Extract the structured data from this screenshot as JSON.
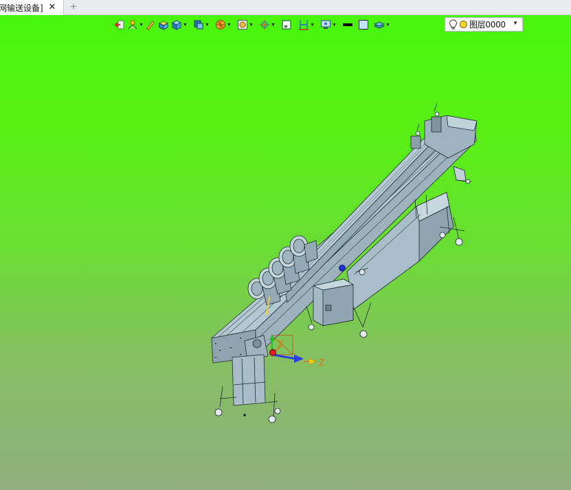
{
  "tab": {
    "title": "网输送设备]",
    "close_icon": "close-icon",
    "add_icon": "plus-icon"
  },
  "toolbar": {
    "buttons": [
      {
        "name": "exit-icon",
        "dropdown": false
      },
      {
        "name": "point-snap-icon",
        "dropdown": true
      },
      {
        "name": "pencil-icon",
        "dropdown": false
      },
      {
        "name": "box-shaded-icon",
        "dropdown": false
      },
      {
        "name": "render-mode-icon",
        "dropdown": true
      },
      {
        "name": "view-orientation-icon",
        "dropdown": true
      },
      {
        "name": "section-view-icon",
        "dropdown": true
      },
      {
        "name": "zoom-view-icon",
        "dropdown": true
      },
      {
        "name": "target-filter-icon",
        "dropdown": true
      },
      {
        "name": "frame-icon",
        "dropdown": false
      },
      {
        "name": "plane-icon",
        "dropdown": true
      },
      {
        "name": "display-settings-icon",
        "dropdown": true
      },
      {
        "name": "line-color-icon",
        "dropdown": false
      },
      {
        "name": "fill-color-icon",
        "dropdown": false
      },
      {
        "name": "layer-stack-icon",
        "dropdown": true
      }
    ]
  },
  "layer_selector": {
    "value": "图层0000",
    "visible_icon": "light-bulb-icon",
    "status_icon": "layer-dot-icon",
    "color": "#f3d52b"
  },
  "axes": {
    "x_label": "X",
    "z_label": "Z",
    "colors": {
      "x": "#e0701a",
      "y": "#20c020",
      "z": "#2a3fe0"
    }
  },
  "colors": {
    "viewport_top": "#49f50b",
    "viewport_bottom": "#8fae7d",
    "model": "#a6bcc6",
    "model_edge": "#1d2a30"
  }
}
